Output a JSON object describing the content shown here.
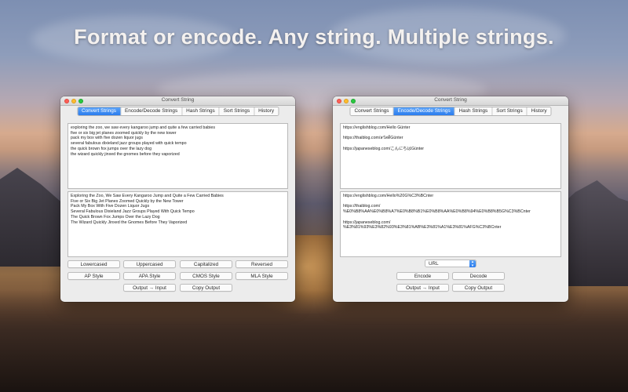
{
  "headline": "Format or encode. Any string. Multiple strings.",
  "left_window": {
    "title": "Convert String",
    "tabs": [
      "Convert Strings",
      "Encode/Decode Strings",
      "Hash Strings",
      "Sort Strings",
      "History"
    ],
    "active_tab": "Convert Strings",
    "input_lines": [
      "exploring the zoo, we saw every kangaroo jump and quite a few carried babies",
      "five or six big jet planes zoomed quickly by the new tower",
      "pack my box with five dozen liquor jugs",
      "several fabulous dixieland jazz groups played with quick tempo",
      "the quick brown fox jumps over the lazy dog",
      "the wizard quickly jinxed the gnomes before they vaporized"
    ],
    "output_lines": [
      "Exploring the Zoo, We Saw Every Kangaroo Jump and Quite a Few Carried Babies",
      "Five or Six Big Jet Planes Zoomed Quickly by the New Tower",
      "Pack My Box With Five Dozen Liquor Jugs",
      "Several Fabulous Dixieland Jazz Groups Played With Quick Tempo",
      "The Quick Brown Fox Jumps Over the Lazy Dog",
      "The Wizard Quickly Jinxed the Gnomes Before They Vaporized"
    ],
    "buttons": {
      "lowercased": "Lowercased",
      "uppercased": "Uppercased",
      "capitalized": "Capitalized",
      "reversed": "Reversed",
      "ap_style": "AP Style",
      "apa_style": "APA Style",
      "cmos_style": "CMOS Style",
      "mla_style": "MLA Style",
      "output_to_input": "Output → Input",
      "copy_output": "Copy Output"
    }
  },
  "right_window": {
    "title": "Convert String",
    "tabs": [
      "Convert Strings",
      "Encode/Decode Strings",
      "Hash Strings",
      "Sort Strings",
      "History"
    ],
    "active_tab": "Encode/Decode Strings",
    "input_lines": [
      "https://englishblog.com/Hello Günter",
      "",
      "https://thaiblog.com/สวัสดีGünter",
      "",
      "https://japaneseblog.com/こんにちはGünter"
    ],
    "output_lines": [
      "https://englishblog.com/Hello%20G%C3%BCnter",
      "",
      "https://thaiblog.com/",
      "%E0%B8%AA%E0%B8%A7%E0%B8%B1%E0%B8%AA%E0%B8%94%E0%B8%B5G%C3%BCnter",
      "",
      "https://japaneseblog.com/",
      "%E3%81%93%E3%82%93%E3%81%AB%E3%81%A1%E3%81%AFG%C3%BCnter"
    ],
    "encoding_select": "URL",
    "buttons": {
      "encode": "Encode",
      "decode": "Decode",
      "output_to_input": "Output → Input",
      "copy_output": "Copy Output"
    }
  },
  "colors": {
    "accent": "#2b7cee",
    "close": "#fd5f57",
    "minimize": "#febc2e",
    "maximize": "#2ac840"
  }
}
